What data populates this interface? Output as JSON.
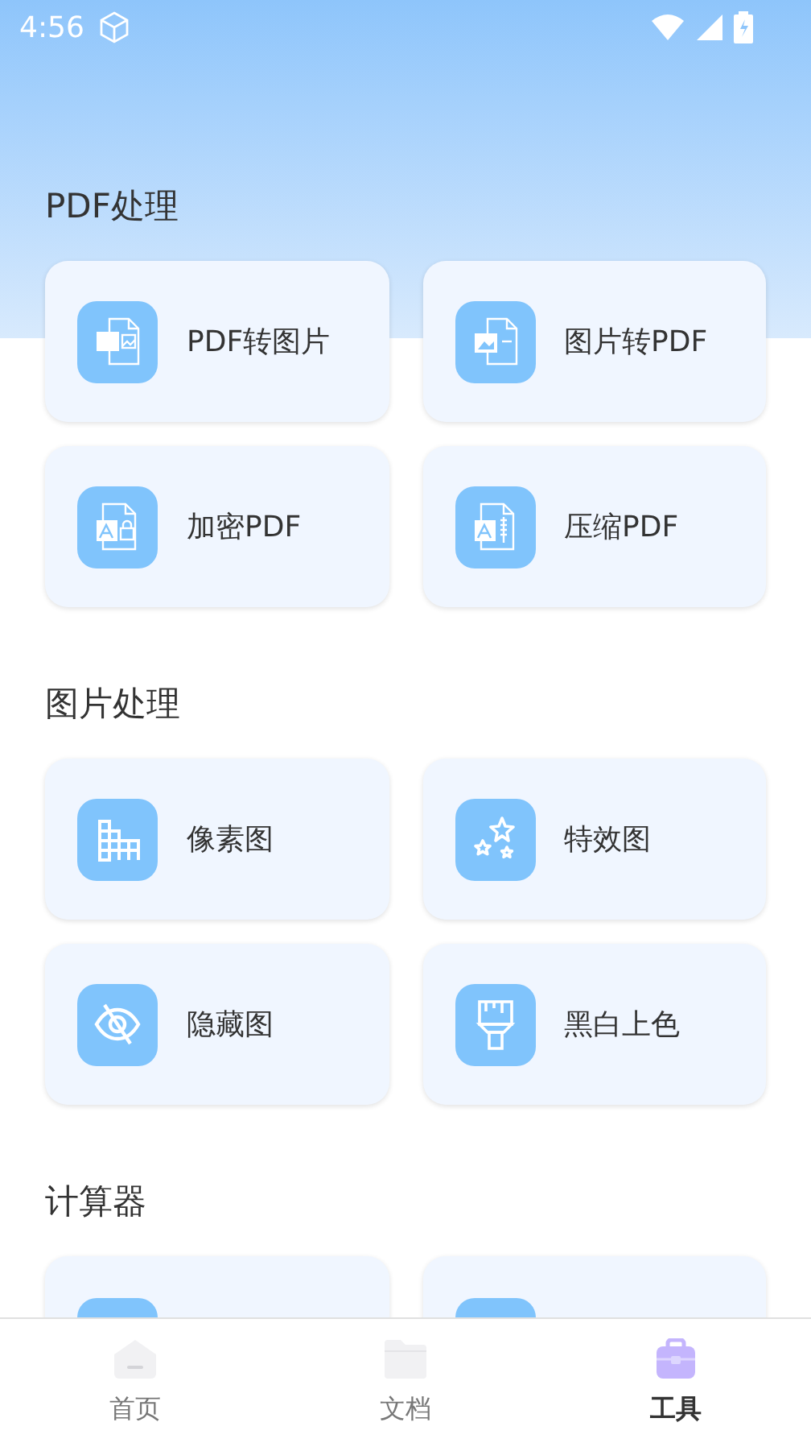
{
  "status_bar": {
    "time": "4:56"
  },
  "sections": [
    {
      "title": "PDF处理",
      "tools": [
        {
          "kind": "full",
          "label": "PDF转图片"
        },
        {
          "kind": "full",
          "label": "图片转PDF"
        },
        {
          "kind": "full",
          "label": "加密PDF"
        },
        {
          "kind": "full",
          "label": "压缩PDF"
        }
      ]
    },
    {
      "title": "图片处理",
      "tools": [
        {
          "kind": "full",
          "label": "像素图"
        },
        {
          "kind": "full",
          "label": "特效图"
        },
        {
          "kind": "full",
          "label": "隐藏图"
        },
        {
          "kind": "full",
          "label": "黑白上色"
        }
      ]
    },
    {
      "title": "计算器",
      "tools": [
        {
          "kind": "partial"
        },
        {
          "kind": "partial"
        }
      ]
    }
  ],
  "bottom_nav": [
    {
      "label": "首页",
      "selected": false
    },
    {
      "label": "文档",
      "selected": false
    },
    {
      "label": "工具",
      "selected": true
    }
  ]
}
